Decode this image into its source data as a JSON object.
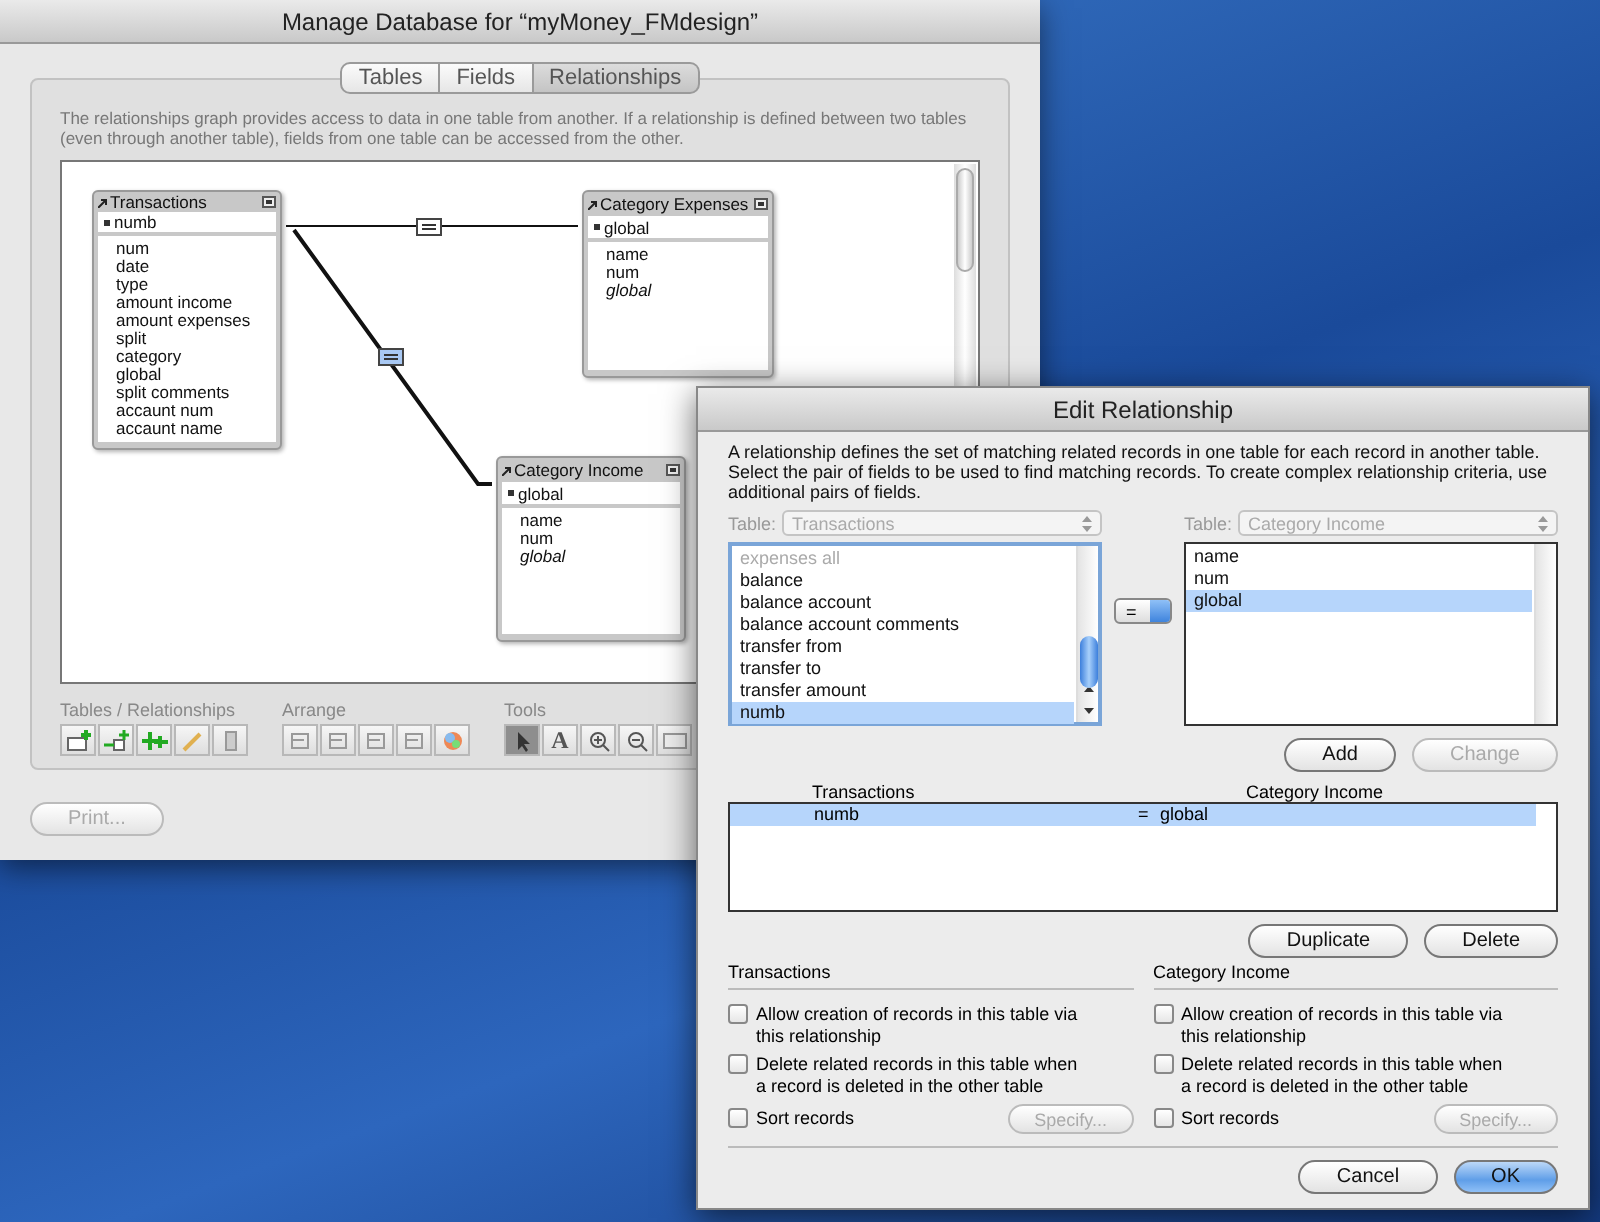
{
  "main_window": {
    "title": "Manage Database for “myMoney_FMdesign”",
    "tabs": [
      {
        "label": "Tables",
        "selected": false
      },
      {
        "label": "Fields",
        "selected": false
      },
      {
        "label": "Relationships",
        "selected": true
      }
    ],
    "description": "The relationships graph provides access to data in one table from another. If a relationship is defined between two tables (even through another table), fields from one table can be accessed from the other.",
    "graph": {
      "tables": [
        {
          "name": "Transactions",
          "key_field": "numb",
          "fields": [
            {
              "name": "num",
              "italic": false
            },
            {
              "name": "date",
              "italic": false
            },
            {
              "name": "type",
              "italic": false
            },
            {
              "name": "amount income",
              "italic": false
            },
            {
              "name": "amount expenses",
              "italic": false
            },
            {
              "name": "split",
              "italic": false
            },
            {
              "name": "category",
              "italic": false
            },
            {
              "name": "global",
              "italic": false
            },
            {
              "name": "split comments",
              "italic": false
            },
            {
              "name": "accaunt num",
              "italic": false
            },
            {
              "name": "accaunt name",
              "italic": false
            }
          ]
        },
        {
          "name": "Category Expenses",
          "key_field": "global",
          "fields": [
            {
              "name": "name",
              "italic": false
            },
            {
              "name": "num",
              "italic": false
            },
            {
              "name": "global",
              "italic": true
            }
          ]
        },
        {
          "name": "Category Income",
          "key_field": "global",
          "fields": [
            {
              "name": "name",
              "italic": false
            },
            {
              "name": "num",
              "italic": false
            },
            {
              "name": "global",
              "italic": true
            }
          ]
        }
      ],
      "relationships": [
        {
          "selected": false
        },
        {
          "selected": true
        }
      ]
    },
    "toolbar": {
      "groups": [
        {
          "label": "Tables / Relationships",
          "tools": [
            {
              "kind": "add-table",
              "selected": false
            },
            {
              "kind": "add-relationship",
              "selected": false
            },
            {
              "kind": "duplicate",
              "selected": false
            },
            {
              "kind": "edit",
              "selected": false
            },
            {
              "kind": "delete",
              "selected": false
            }
          ]
        },
        {
          "label": "Arrange",
          "tools": [
            {
              "kind": "align",
              "selected": false
            },
            {
              "kind": "align",
              "selected": false
            },
            {
              "kind": "align",
              "selected": false
            },
            {
              "kind": "align",
              "selected": false
            },
            {
              "kind": "color",
              "selected": false
            }
          ]
        },
        {
          "label": "Tools",
          "tools": [
            {
              "kind": "pointer",
              "selected": true
            },
            {
              "kind": "text",
              "selected": false,
              "text": "A"
            },
            {
              "kind": "zoom-in",
              "selected": false
            },
            {
              "kind": "zoom-out",
              "selected": false
            },
            {
              "kind": "page",
              "selected": false
            }
          ]
        }
      ]
    },
    "print_button": "Print..."
  },
  "dialog": {
    "title": "Edit Relationship",
    "description": "A relationship defines the set of matching related records in one table for each record in another table. Select the pair of fields to be used to find matching records. To create complex relationship criteria, use additional pairs of fields.",
    "left": {
      "table_label": "Table:",
      "table": "Transactions",
      "fields": [
        {
          "name": "expenses all",
          "disabled": true,
          "selected": false
        },
        {
          "name": "balance",
          "disabled": false,
          "selected": false
        },
        {
          "name": "balance account",
          "disabled": false,
          "selected": false
        },
        {
          "name": "balance account comments",
          "disabled": false,
          "selected": false
        },
        {
          "name": "transfer from",
          "disabled": false,
          "selected": false
        },
        {
          "name": "transfer to",
          "disabled": false,
          "selected": false
        },
        {
          "name": "transfer amount",
          "disabled": false,
          "selected": false
        },
        {
          "name": "numb",
          "disabled": false,
          "selected": true
        }
      ]
    },
    "operator": "=",
    "right": {
      "table_label": "Table:",
      "table": "Category Income",
      "fields": [
        {
          "name": "name",
          "disabled": false,
          "selected": false
        },
        {
          "name": "num",
          "disabled": false,
          "selected": false
        },
        {
          "name": "global",
          "disabled": false,
          "selected": true
        }
      ]
    },
    "add_button": {
      "label": "Add",
      "disabled": false
    },
    "change_button": {
      "label": "Change",
      "disabled": true
    },
    "criteria": {
      "columns": [
        "Transactions",
        "Category Income"
      ],
      "rows": [
        {
          "left": "numb",
          "operator": "=",
          "right": "global",
          "selected": true
        }
      ]
    },
    "duplicate_button": "Duplicate",
    "delete_button": "Delete",
    "options": [
      {
        "title": "Transactions",
        "checkboxes": [
          {
            "label": "Allow creation of records in this table via this relationship",
            "checked": false
          },
          {
            "label": "Delete related records in this table when a record is deleted in the other table",
            "checked": false
          },
          {
            "label": "Sort records",
            "checked": false
          }
        ],
        "specify": "Specify..."
      },
      {
        "title": "Category Income",
        "checkboxes": [
          {
            "label": "Allow creation of records in this table via this relationship",
            "checked": false
          },
          {
            "label": "Delete related records in this table when a record is deleted in the other table",
            "checked": false
          },
          {
            "label": "Sort records",
            "checked": false
          }
        ],
        "specify": "Specify..."
      }
    ],
    "cancel_button": "Cancel",
    "ok_button": "OK"
  }
}
